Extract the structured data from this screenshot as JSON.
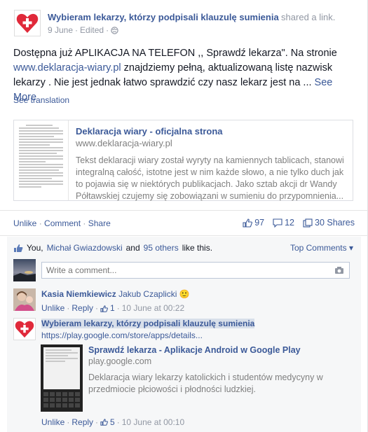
{
  "post": {
    "page_name": "Wybieram lekarzy, którzy podpisali klauzulę sumienia",
    "action": "shared a link.",
    "date": "9 June",
    "edited": "Edited",
    "text_main": "Dostępna już APLIKACJA NA TELEFON ,, Sprawdź lekarza\". Na stronie",
    "text_link": "www.deklaracja-wiary.pl",
    "text_rest": " znajdziemy pełną, aktualizowaną listę nazwisk lekarzy . Nie jest jednak łatwo sprawdzić czy nasz lekarz jest na ...",
    "see_more": "See More",
    "see_translation": "See translation"
  },
  "shared_link": {
    "title": "Deklaracja wiary - oficjalna strona",
    "url": "www.deklaracja-wiary.pl",
    "description": "Tekst deklaracji wiary został wyryty na kamiennych tablicach, stanowi integralną całość, istotne jest w nim każde słowo, a nie tylko duch jak to pojawia się w niektórych publikacjach. Jako sztab akcji dr Wandy Półtawskiej czujemy się zobowiązani w sumieniu do przypomnienia..."
  },
  "actions": {
    "unlike": "Unlike",
    "comment": "Comment",
    "share": "Share",
    "sep": " · "
  },
  "stats": {
    "likes": "97",
    "comments": "12",
    "shares": "30 Shares"
  },
  "likes_row": {
    "you": "You,",
    "person": "Michał Gwiazdowski",
    "and": "and",
    "others": "95 others",
    "suffix": "like this."
  },
  "top_comments": "Top Comments ▾",
  "write_comment_placeholder": "Write a comment...",
  "comments": [
    {
      "author": "Kasia Niemkiewicz",
      "text": "Jakub Czaplicki",
      "emoji": "🙂",
      "unlike": "Unlike",
      "reply": "Reply",
      "likes": "1",
      "time": "10 June at 00:22"
    },
    {
      "author": "Wybieram lekarzy, którzy podpisali klauzulę sumienia",
      "link": "https://play.google.com/store/apps/details...",
      "unlike": "Unlike",
      "reply": "Reply",
      "likes": "5",
      "time": "10 June at 00:10"
    }
  ],
  "inner_link": {
    "title": "Sprawdź lekarza - Aplikacje Android w Google Play",
    "url": "play.google.com",
    "description": "Deklaracja wiary lekarzy katolickich i studentów medycyny w przedmiocie płciowości i płodności ludzkiej."
  },
  "colors": {
    "brand_red": "#e0293a",
    "link_blue": "#3b5998",
    "meta_gray": "#9197a3"
  }
}
